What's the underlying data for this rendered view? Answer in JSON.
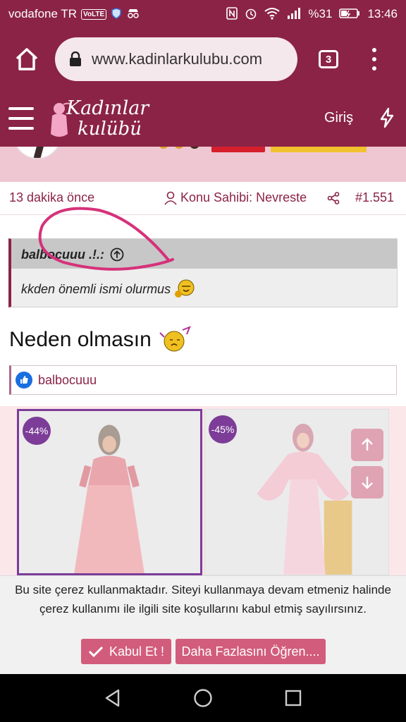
{
  "status_bar": {
    "carrier": "vodafone TR",
    "lte_badge": "VoLTE",
    "battery": "%31",
    "time": "13:46"
  },
  "browser": {
    "url": "www.kadinlarkulubu.com",
    "tab_count": "3"
  },
  "site": {
    "logo_line1": "Kadınlar",
    "logo_line2": "kulübü",
    "login": "Giriş"
  },
  "post": {
    "time_ago": "13 dakika önce",
    "owner_label": "Konu Sahibi: Nevreste",
    "post_number": "#1.551",
    "quote_author": "balbocuuu .!.:",
    "quote_text": "kkden önemli ismi olurmus",
    "body_text": "Neden olmasın",
    "liked_by": "balbocuuu"
  },
  "ads": {
    "products": [
      {
        "discount": "-44%"
      },
      {
        "discount": "-45%"
      }
    ]
  },
  "cookie": {
    "message": "Bu site çerez kullanmaktadır. Siteyi kullanmaya devam etmeniz halinde çerez kullanımı ile ilgili site koşullarını kabul etmiş sayılırsınız.",
    "accept": "Kabul Et !",
    "learn_more": "Daha Fazlasını Öğren...."
  },
  "colors": {
    "brand": "#8b2347",
    "accent_purple": "#7d3c98",
    "button_pink": "#d25c7b",
    "scribble": "#d6317a"
  }
}
